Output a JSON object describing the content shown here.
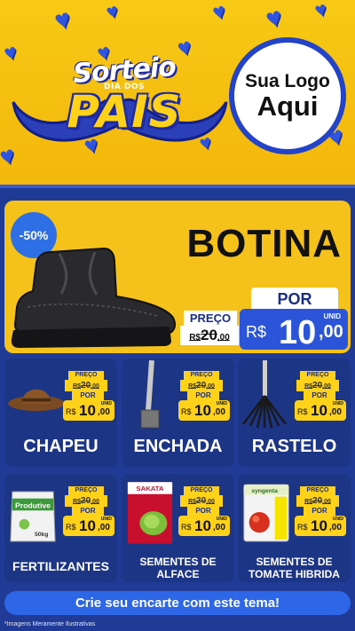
{
  "header": {
    "title_line1": "Sorteio",
    "title_line2": "DIA DOS",
    "title_line3": "PAIS",
    "logo_line1": "Sua Logo",
    "logo_line2": "Aqui"
  },
  "hero": {
    "discount_badge": "-50%",
    "product_name": "BOTINA",
    "price_label": "PREÇO",
    "old_price_currency": "R$",
    "old_price_int": "20",
    "old_price_dec": ",00",
    "por_label": "POR",
    "unit_label": "UNID",
    "currency": "R$",
    "new_price_int": "10",
    "new_price_dec": ",00"
  },
  "price_tag": {
    "preco_label": "PREÇO",
    "old_currency": "R$",
    "old_int": "20",
    "old_dec": ",00",
    "por_label": "POR",
    "currency": "R$",
    "new_int": "10",
    "new_dec": ",00",
    "unit_label": "UNID"
  },
  "products": [
    {
      "name": "CHAPEU",
      "icon": "hat-icon"
    },
    {
      "name": "ENCHADA",
      "icon": "hoe-icon"
    },
    {
      "name": "RASTELO",
      "icon": "rake-icon"
    },
    {
      "name": "FERTILIZANTES",
      "icon": "fertilizer-bag-icon",
      "brand": "Produtive",
      "weight": "50kg"
    },
    {
      "name_line1": "SEMENTES DE",
      "name_line2": "ALFACE",
      "icon": "seed-packet-icon",
      "brand": "SAKATA"
    },
    {
      "name_line1": "SEMENTES DE",
      "name_line2": "TOMATE HIBRIDA",
      "icon": "seed-packet-icon",
      "brand": "syngenta"
    }
  ],
  "cta_label": "Crie seu encarte com este tema!",
  "disclaimer": "*Imagens Meramente Ilustrativas",
  "colors": {
    "yellow": "#f5c10a",
    "navy": "#1f3b96",
    "blue": "#2b54d9"
  }
}
